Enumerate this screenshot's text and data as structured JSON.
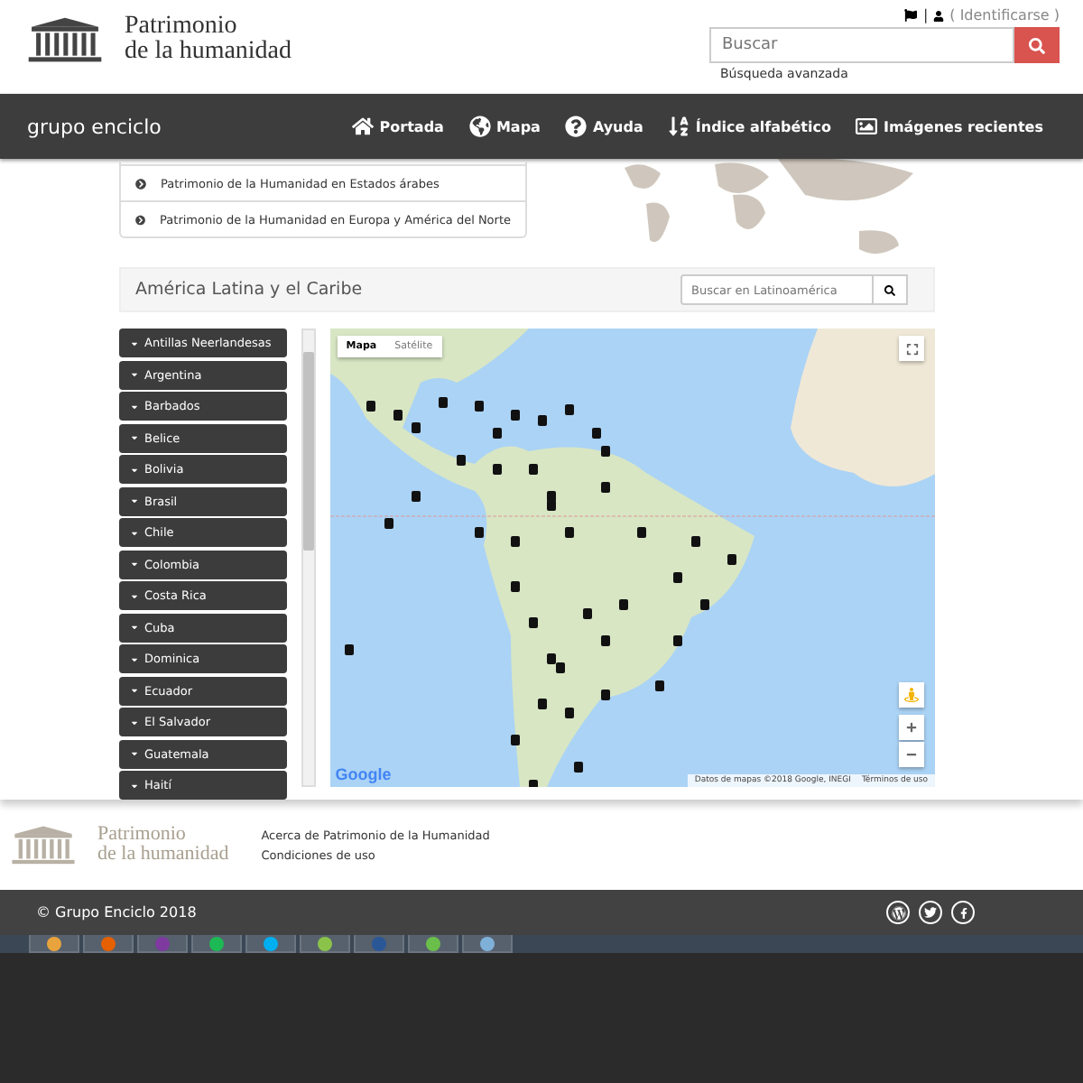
{
  "header": {
    "logo_line1": "Patrimonio",
    "logo_line2": "de la humanidad",
    "separator": "|",
    "login": "( Identificarse )",
    "search": {
      "placeholder": "Buscar"
    },
    "advanced_search": "Búsqueda avanzada"
  },
  "nav": {
    "brand": "grupo enciclo",
    "items": [
      {
        "label": "Portada",
        "kind": "home"
      },
      {
        "label": "Mapa",
        "kind": "globe"
      },
      {
        "label": "Ayuda",
        "kind": "help"
      },
      {
        "label": "Índice alfabético",
        "kind": "sort"
      },
      {
        "label": "Imágenes recientes",
        "kind": "image"
      }
    ]
  },
  "regions": [
    "Patrimonio de la Humanidad en Estados árabes",
    "Patrimonio de la Humanidad en Europa y América del Norte"
  ],
  "panel": {
    "title": "América Latina y el Caribe",
    "search": {
      "placeholder": "Buscar en Latinoamérica"
    },
    "countries": [
      {
        "label": "Antillas Neerlandesas"
      },
      {
        "label": "Argentina"
      },
      {
        "label": "Barbados"
      },
      {
        "label": "Belice"
      },
      {
        "label": "Bolivia"
      },
      {
        "label": "Brasil"
      },
      {
        "label": "Chile"
      },
      {
        "label": "Colombia"
      },
      {
        "label": "Costa Rica"
      },
      {
        "label": "Cuba"
      },
      {
        "label": "Dominica"
      },
      {
        "label": "Ecuador"
      },
      {
        "label": "El Salvador"
      },
      {
        "label": "Guatemala"
      },
      {
        "label": "Haití"
      }
    ],
    "map": {
      "types": [
        {
          "label": "Mapa",
          "selected": true
        },
        {
          "label": "Satélite",
          "selected": false
        }
      ],
      "attribution": "Datos de mapas ©2018 Google, INEGI",
      "terms": "Términos de uso",
      "google": "Google"
    }
  },
  "footer": {
    "logo_line1": "Patrimonio",
    "logo_line2": "de la humanidad",
    "links": [
      "Acerca de Patrimonio de la Humanidad",
      "Condiciones de uso"
    ],
    "copyright": "© Grupo Enciclo 2018"
  }
}
